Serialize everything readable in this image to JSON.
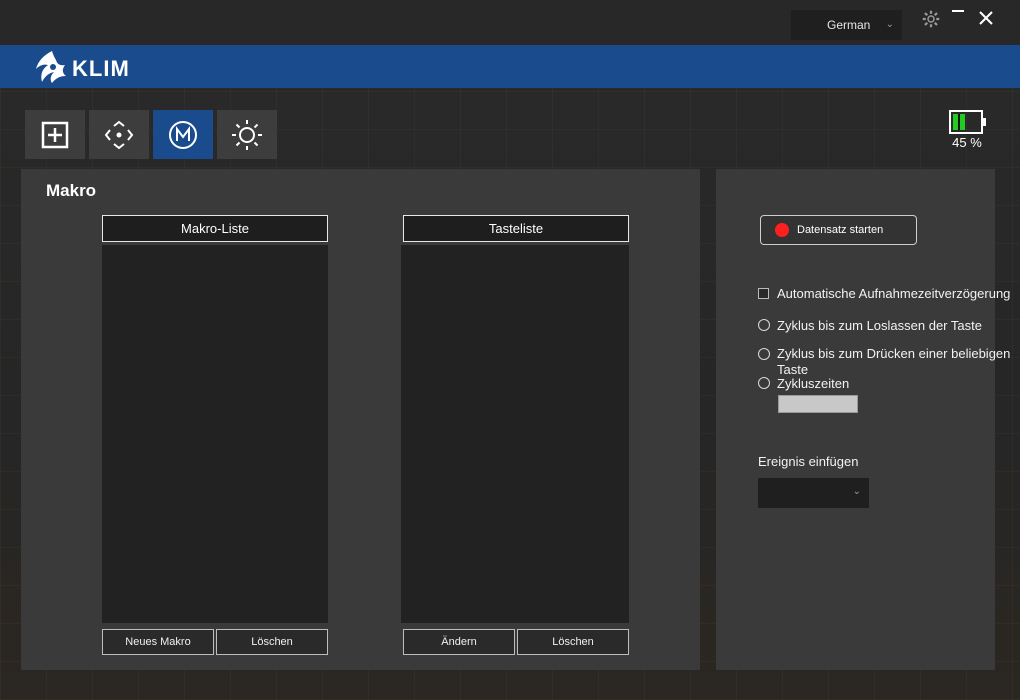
{
  "window": {
    "language": {
      "selected": "German"
    },
    "icons": {
      "settings": "gear-icon",
      "minimize": "minimize-icon",
      "close": "close-icon"
    }
  },
  "brand": {
    "name": "KLIM"
  },
  "tabs": [
    {
      "id": "buttons",
      "icon": "plus-square-icon",
      "active": false
    },
    {
      "id": "dpi",
      "icon": "move-arrows-icon",
      "active": false
    },
    {
      "id": "macro",
      "icon": "macro-m-icon",
      "active": true
    },
    {
      "id": "lighting",
      "icon": "sun-icon",
      "active": false
    }
  ],
  "battery": {
    "level_percent": 45,
    "text": "45 %",
    "color": "#22cc22"
  },
  "macro": {
    "title": "Makro",
    "macro_list": {
      "header": "Makro-Liste",
      "items": [],
      "new_label": "Neues Makro",
      "delete_label": "Löschen"
    },
    "key_list": {
      "header": "Tasteliste",
      "items": [],
      "edit_label": "Ändern",
      "delete_label": "Löschen"
    }
  },
  "recording": {
    "start_label": "Datensatz starten",
    "dot_color": "#ff1f1f",
    "auto_delay": {
      "label": "Automatische Aufnahmezeitverzögerung",
      "checked": false
    },
    "modes": [
      {
        "label": "Zyklus bis zum Loslassen der Taste",
        "selected": false
      },
      {
        "label": "Zyklus bis zum Drücken einer beliebigen Taste",
        "selected": false
      },
      {
        "label": "Zykluszeiten",
        "selected": false
      }
    ],
    "cycle_count": "",
    "insert_event": {
      "label": "Ereignis einfügen",
      "selected": ""
    }
  },
  "colors": {
    "accent": "#1a4b8c",
    "panel": "#3a3a3a",
    "list_bg": "#222222"
  }
}
